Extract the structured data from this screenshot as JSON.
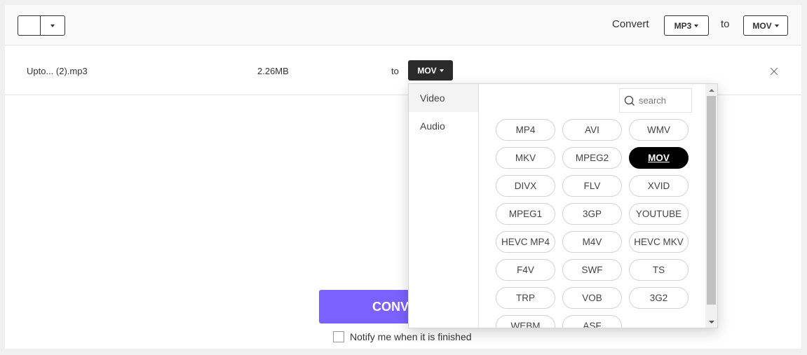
{
  "header": {
    "convert_label": "Convert",
    "from_format": "MP3",
    "to_label": "to",
    "to_format": "MOV"
  },
  "file": {
    "name": "Upto... (2).mp3",
    "size": "2.26MB",
    "to_label": "to",
    "target_format": "MOV"
  },
  "dropdown": {
    "categories": [
      "Video",
      "Audio"
    ],
    "active_category": "Video",
    "search_placeholder": "search",
    "formats": [
      "MP4",
      "AVI",
      "WMV",
      "MKV",
      "MPEG2",
      "MOV",
      "DIVX",
      "FLV",
      "XVID",
      "MPEG1",
      "3GP",
      "YOUTUBE",
      "HEVC MP4",
      "M4V",
      "HEVC MKV",
      "F4V",
      "SWF",
      "TS",
      "TRP",
      "VOB",
      "3G2",
      "WEBM",
      "ASF"
    ],
    "selected_format": "MOV"
  },
  "actions": {
    "convert_label": "CONVERT",
    "notify_label": "Notify me when it is finished",
    "notify_checked": false
  },
  "colors": {
    "accent": "#7b61ff",
    "selected_pill": "#000000",
    "row_format_button": "#2b2b2b"
  }
}
